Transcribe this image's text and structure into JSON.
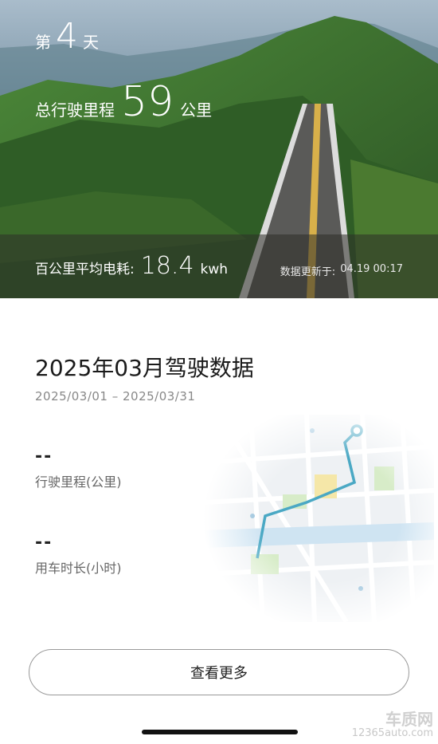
{
  "hero": {
    "day_prefix": "第",
    "day_number": "4",
    "day_suffix": "天",
    "mileage_label": "总行驶里程",
    "mileage_value": "59",
    "mileage_unit": "公里",
    "avg_label": "百公里平均电耗:",
    "avg_value": "18.4",
    "avg_unit": "kwh",
    "update_label": "数据更新于:",
    "update_time": "04.19 00:17"
  },
  "report": {
    "title": "2025年03月驾驶数据",
    "date_range": "2025/03/01 – 2025/03/31",
    "stats": [
      {
        "value": "--",
        "label": "行驶里程(公里)"
      },
      {
        "value": "--",
        "label": "用车时长(小时)"
      }
    ],
    "more_button": "查看更多"
  },
  "watermark": {
    "line1": "车质网",
    "line2": "12365auto.com"
  }
}
